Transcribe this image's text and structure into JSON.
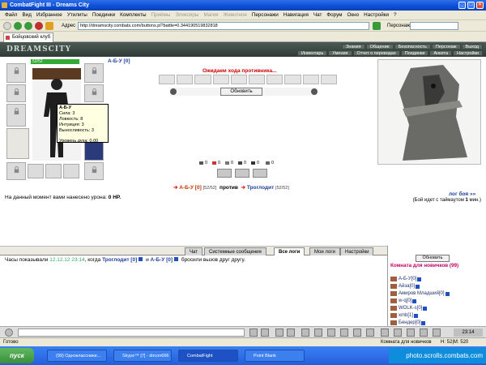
{
  "window": {
    "title": "CombatFight III - Dreams City"
  },
  "menu": [
    "Файл",
    "Вид",
    "Избранное",
    "Утилиты",
    "Поединки",
    "Комплекты",
    "Приёмы",
    "Эликсиры",
    "Магия",
    "Животное",
    "Персонажи",
    "Навигация",
    "Чат",
    "Форум",
    "Окно",
    "Настройки",
    "?"
  ],
  "menu_dim": [
    6,
    7,
    8,
    9
  ],
  "address": {
    "label": "Адрес",
    "value": "http://dreamscity.combats.com/buttons.pl?battle=0.344190519832818"
  },
  "persona_label": "Персонаж:",
  "tab": {
    "label": "Бойцовский клуб"
  },
  "logo": "DREAMSCITY",
  "top_nav_1": [
    "Знания",
    "Общение",
    "Безопасность",
    "Персонаж",
    "Выход"
  ],
  "top_nav_2": [
    "Инвентарь",
    "Умения",
    "Отчет о переводах",
    "Поединки",
    "Анкета",
    "Настройки"
  ],
  "player": {
    "name": "А-Б-У [0]",
    "hp": "52/52"
  },
  "tooltip": {
    "name": "А-Б-У",
    "lines": [
      "Сила: 3",
      "Ловкость: 8",
      "Интуиция: 3",
      "Выносливость: 3",
      "",
      "Уровень духа: 0.00"
    ]
  },
  "battle": {
    "status": "Ожидаем хода противника...",
    "refresh_label": "Обновить",
    "stats": [
      "0",
      "0",
      "0",
      "0",
      "0",
      "0"
    ],
    "me_name": "А-Б-У [0]",
    "me_hp": "[52/52]",
    "vs": "против",
    "enemy_name": "Троглодит",
    "enemy_hp": "[52/52]",
    "damage_text": "На данный момент вами нанесено урона:",
    "damage_value": "0 HP.",
    "log_link": "лог боя »»",
    "timeout_prefix": "(Бой идет с таймаутом",
    "timeout_value": "1",
    "timeout_suffix": "мин.)"
  },
  "chat_tabs": [
    "Чат",
    "Системные сообщения",
    "Все логи",
    "Мои логи",
    "Настройки"
  ],
  "chat_active": 2,
  "chat_message": {
    "prefix": "Часы показывали",
    "time": "12.12.12 23:14",
    "middle": ", когда",
    "name1": "Троглодит [0]",
    "and": "и",
    "name2": "А-Б-У [0]",
    "suffix": "бросили вызов друг другу."
  },
  "room": {
    "refresh_label": "Обновить",
    "title": "Комната для новичков (99)",
    "users": [
      "А-Б-У[0]",
      "Айза[0]",
      "Амиров Младший[0]",
      "w-q[0]",
      "WOLK-s[0]",
      "xmb[1]",
      "Бендер[0]"
    ]
  },
  "clock": "23:14",
  "statusbar": {
    "left": "Готово",
    "room": "Комната для новичков",
    "coords": "H: 52|M: 520"
  },
  "taskbar": {
    "start": "пуск",
    "tasks": [
      "(99) Одноклассники...",
      "Skype™ [7] - dircon666",
      "CombatFight",
      "Point Blank"
    ],
    "tray_text": "photo.scrolls.combats.com"
  }
}
